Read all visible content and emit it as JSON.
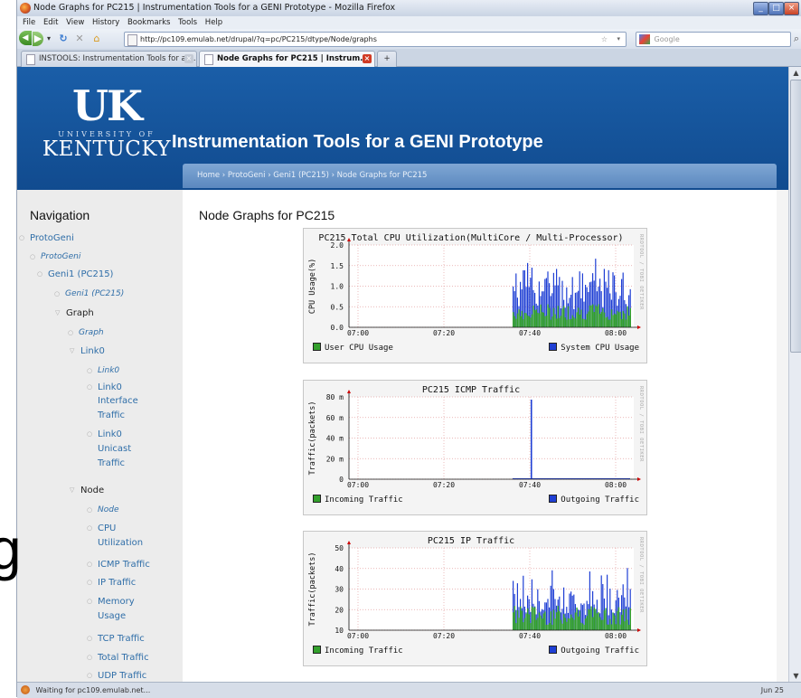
{
  "window": {
    "title": "Node Graphs for PC215 | Instrumentation Tools for a GENI Prototype - Mozilla Firefox",
    "controls": [
      "_",
      "□",
      "×"
    ]
  },
  "menubar": [
    "File",
    "Edit",
    "View",
    "History",
    "Bookmarks",
    "Tools",
    "Help"
  ],
  "navbar": {
    "url": "http://pc109.emulab.net/drupal/?q=pc/PC215/dtype/Node/graphs",
    "search_placeholder": "Google"
  },
  "tabs": [
    {
      "label": "INSTOOLS: Instrumentation Tools for a ..."
    },
    {
      "label": "Node Graphs for PC215 | Instrum..."
    },
    {
      "label": "+"
    }
  ],
  "banner": {
    "logo_big": "UK",
    "logo_univ": "UNIVERSITY OF",
    "logo_state": "KENTUCKY",
    "site_title": "Instrumentation Tools for a GENI Prototype",
    "breadcrumb": "Home › ProtoGeni › Geni1 (PC215) › Node Graphs for PC215"
  },
  "sidebar": {
    "heading": "Navigation",
    "items": [
      {
        "label": "ProtoGeni"
      },
      {
        "label": "ProtoGeni"
      },
      {
        "label": "Geni1 (PC215)"
      },
      {
        "label": "Geni1 (PC215)"
      },
      {
        "label": "Graph"
      },
      {
        "label": "Graph"
      },
      {
        "label": "Link0"
      },
      {
        "label": "Link0"
      },
      {
        "label": "Link0"
      },
      {
        "label": "Interface"
      },
      {
        "label": "Traffic"
      },
      {
        "label": "Link0"
      },
      {
        "label": "Unicast"
      },
      {
        "label": "Traffic"
      },
      {
        "label": "Node"
      },
      {
        "label": "Node"
      },
      {
        "label": "CPU"
      },
      {
        "label": "Utilization"
      },
      {
        "label": "ICMP Traffic"
      },
      {
        "label": "IP Traffic"
      },
      {
        "label": "Memory"
      },
      {
        "label": "Usage"
      },
      {
        "label": "TCP Traffic"
      },
      {
        "label": "Total Traffic"
      },
      {
        "label": "UDP Traffic"
      }
    ]
  },
  "main": {
    "page_title": "Node Graphs for PC215"
  },
  "status": {
    "text": "Waiting for pc109.emulab.net...",
    "date": "Jun 25"
  },
  "overlay_char": "g",
  "chart_data": [
    {
      "type": "area",
      "title": "PC215 Total CPU Utilization(MultiCore / Multi-Processor)",
      "ylabel": "CPU Usage(%)",
      "ylim": [
        0,
        2.0
      ],
      "yticks": [
        "2.0",
        "1.5",
        "1.0",
        "0.5",
        "0.0"
      ],
      "xticks": [
        "07:00",
        "07:20",
        "07:40",
        "08:00"
      ],
      "side_text": "RRDTOOL / TOBI OETIKER",
      "colors": {
        "incoming": "#33a02c",
        "outgoing": "#1f3fd4"
      },
      "series": [
        {
          "name": "User CPU Usage"
        },
        {
          "name": "System CPU Usage"
        }
      ]
    },
    {
      "type": "area",
      "title": "PC215 ICMP Traffic",
      "ylabel": "Traffic(packets)",
      "ylim": [
        0,
        80
      ],
      "yticks": [
        "80 m",
        "60 m",
        "40 m",
        "20 m",
        "0"
      ],
      "xticks": [
        "07:00",
        "07:20",
        "07:40",
        "08:00"
      ],
      "side_text": "RRDTOOL / TOBI OETIKER",
      "colors": {
        "incoming": "#33a02c",
        "outgoing": "#1f3fd4"
      },
      "series": [
        {
          "name": "Incoming Traffic"
        },
        {
          "name": "Outgoing Traffic"
        }
      ]
    },
    {
      "type": "area",
      "title": "PC215 IP Traffic",
      "ylabel": "Traffic(packets)",
      "ylim": [
        0,
        50
      ],
      "yticks": [
        "50",
        "40",
        "30",
        "20",
        "10"
      ],
      "xticks": [
        "07:00",
        "07:20",
        "07:40",
        "08:00"
      ],
      "side_text": "RRDTOOL / TOBI OETIKER",
      "colors": {
        "incoming": "#33a02c",
        "outgoing": "#1f3fd4"
      },
      "series": [
        {
          "name": "Incoming Traffic"
        },
        {
          "name": "Outgoing Traffic"
        }
      ]
    }
  ]
}
